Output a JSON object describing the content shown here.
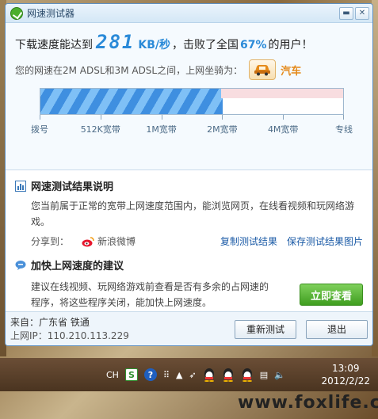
{
  "window": {
    "title": "网速测试器",
    "min_symbol": "▬",
    "close_symbol": "✕"
  },
  "result": {
    "headline_prefix": "下载速度能达到",
    "speed_value": "281",
    "speed_unit": "KB/秒",
    "headline_mid": "，击败了全国",
    "beat_percent": "67%",
    "headline_suffix": "的用户！",
    "compare_text": "您的网速在2M ADSL和3M ADSL之间，上网坐骑为：",
    "vehicle_label": "汽车",
    "vehicle_icon": "car-icon",
    "bar_fill_fraction": 0.6
  },
  "scale": {
    "labels": [
      "拨号",
      "512K宽带",
      "1M宽带",
      "2M宽带",
      "4M宽带",
      "专线"
    ]
  },
  "explanation": {
    "title": "网速测试结果说明",
    "text": "您当前属于正常的宽带上网速度范围内，能浏览网页，在线看视频和玩网络游戏。",
    "share_label": "分享到：",
    "share_target": "新浪微博",
    "copy_link": "复制测试结果",
    "save_link": "保存测试结果图片"
  },
  "advice": {
    "title": "加快上网速度的建议",
    "text": "建议在线视频、玩网络游戏前查看是否有多余的占网速的程序，将这些程序关闭，能加快上网速度。",
    "button": "立即查看"
  },
  "footer": {
    "from": "来自：广东省 铁通",
    "ip": "上网IP：110.210.113.229",
    "retest": "重新测试",
    "exit": "退出"
  },
  "taskbar": {
    "lang": "CH",
    "time": "13:09",
    "date": "2012/2/22"
  },
  "watermark": "www.foxlife.cn",
  "colors": {
    "accent": "#2a8ad8",
    "vehicle": "#e58a1a",
    "button_green": "#3f9e1f",
    "link": "#1a5aa6"
  }
}
